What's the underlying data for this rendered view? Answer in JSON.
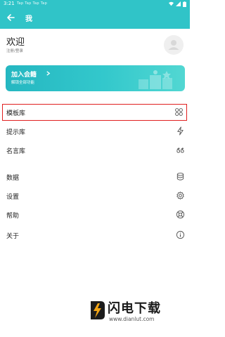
{
  "status_bar": {
    "time": "3:21",
    "notifications": "Tap Tap Tap Tap"
  },
  "app_bar": {
    "title": "我"
  },
  "profile": {
    "welcome": "欢迎",
    "login_link": "注册/登录"
  },
  "vip_banner": {
    "title": "加入会籍",
    "subtitle": "解锁全部功能"
  },
  "menu": {
    "items": [
      {
        "label": "模板库",
        "icon": "grid-icon"
      },
      {
        "label": "提示库",
        "icon": "lightning-icon"
      },
      {
        "label": "名言库",
        "icon": "quote-icon"
      },
      {
        "label": "数据",
        "icon": "database-icon"
      },
      {
        "label": "设置",
        "icon": "gear-icon"
      },
      {
        "label": "帮助",
        "icon": "lifebuoy-icon"
      },
      {
        "label": "关于",
        "icon": "info-icon"
      }
    ]
  },
  "watermark": {
    "brand": "闪电下载",
    "url": "www.dianlut.com"
  },
  "colors": {
    "accent": "#30c4c8",
    "highlight": "#e02020"
  }
}
